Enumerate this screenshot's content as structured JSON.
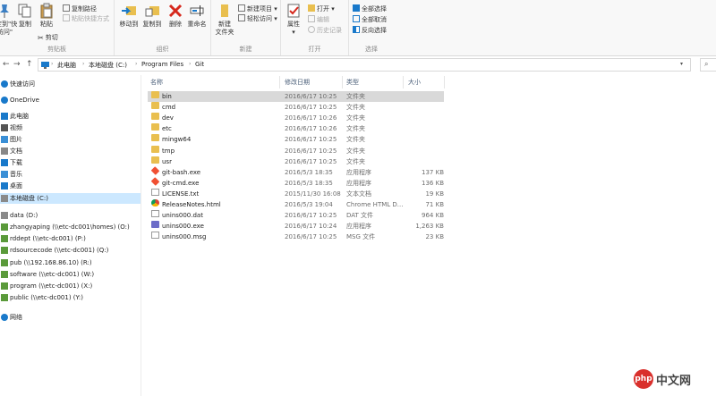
{
  "ribbon": {
    "clipboard": {
      "pin_label": "固定到\"快\n速访问\"",
      "copy_label": "复制",
      "paste_label": "粘贴",
      "copy_path_label": "复制路径",
      "paste_shortcut_label": "粘贴快捷方式",
      "cut_label": "剪切",
      "group_title": "剪贴板"
    },
    "organize": {
      "move_to_label": "移动到",
      "copy_to_label": "复制到",
      "delete_label": "删除",
      "rename_label": "重命名",
      "group_title": "组织"
    },
    "new": {
      "new_folder_label": "新建\n文件夹",
      "new_item_label": "新建项目",
      "easy_access_label": "轻松访问",
      "group_title": "新建"
    },
    "open": {
      "properties_label": "属性",
      "open_label": "打开",
      "edit_label": "编辑",
      "history_label": "历史记录",
      "group_title": "打开"
    },
    "select": {
      "select_all_label": "全部选择",
      "select_none_label": "全部取消",
      "invert_label": "反向选择",
      "group_title": "选择"
    }
  },
  "address": {
    "back": "←",
    "forward": "→",
    "up": "↑",
    "crumbs": [
      "此电脑",
      "本地磁盘 (C:)",
      "Program Files",
      "Git"
    ]
  },
  "nav": {
    "items": [
      {
        "label": "快速访问",
        "icon": "star-icon"
      },
      {
        "label": "OneDrive",
        "icon": "cloud-icon"
      },
      {
        "label": "此电脑",
        "icon": "computer-icon"
      },
      {
        "label": "视频",
        "icon": "video-icon"
      },
      {
        "label": "图片",
        "icon": "picture-icon"
      },
      {
        "label": "文档",
        "icon": "document-icon"
      },
      {
        "label": "下载",
        "icon": "download-icon"
      },
      {
        "label": "音乐",
        "icon": "music-icon"
      },
      {
        "label": "桌面",
        "icon": "desktop-icon"
      },
      {
        "label": "本地磁盘 (C:)",
        "icon": "drive-icon"
      },
      {
        "label": "data (D:)",
        "icon": "drive-icon"
      },
      {
        "label": "zhangyaping (\\\\etc-dc001\\homes) (O:)",
        "icon": "network-drive-icon"
      },
      {
        "label": "rddept (\\\\etc-dc001) (P:)",
        "icon": "network-drive-icon"
      },
      {
        "label": "rdsourcecode (\\\\etc-dc001) (Q:)",
        "icon": "network-drive-icon"
      },
      {
        "label": "pub (\\\\192.168.86.10) (R:)",
        "icon": "network-drive-icon"
      },
      {
        "label": "software (\\\\etc-dc001) (W:)",
        "icon": "network-drive-icon"
      },
      {
        "label": "program (\\\\etc-dc001) (X:)",
        "icon": "network-drive-icon"
      },
      {
        "label": "public (\\\\etc-dc001) (Y:)",
        "icon": "network-drive-icon"
      },
      {
        "label": "网络",
        "icon": "network-icon"
      }
    ]
  },
  "columns": {
    "name": "名称",
    "date": "修改日期",
    "type": "类型",
    "size": "大小"
  },
  "files": [
    {
      "name": "bin",
      "date": "2016/6/17 10:25",
      "type": "文件夹",
      "size": "",
      "icon": "folder-icon"
    },
    {
      "name": "cmd",
      "date": "2016/6/17 10:25",
      "type": "文件夹",
      "size": "",
      "icon": "folder-icon"
    },
    {
      "name": "dev",
      "date": "2016/6/17 10:26",
      "type": "文件夹",
      "size": "",
      "icon": "folder-icon"
    },
    {
      "name": "etc",
      "date": "2016/6/17 10:26",
      "type": "文件夹",
      "size": "",
      "icon": "folder-icon"
    },
    {
      "name": "mingw64",
      "date": "2016/6/17 10:25",
      "type": "文件夹",
      "size": "",
      "icon": "folder-icon"
    },
    {
      "name": "tmp",
      "date": "2016/6/17 10:25",
      "type": "文件夹",
      "size": "",
      "icon": "folder-icon"
    },
    {
      "name": "usr",
      "date": "2016/6/17 10:25",
      "type": "文件夹",
      "size": "",
      "icon": "folder-icon"
    },
    {
      "name": "git-bash.exe",
      "date": "2016/5/3 18:35",
      "type": "应用程序",
      "size": "137 KB",
      "icon": "git-icon"
    },
    {
      "name": "git-cmd.exe",
      "date": "2016/5/3 18:35",
      "type": "应用程序",
      "size": "136 KB",
      "icon": "git-icon"
    },
    {
      "name": "LICENSE.txt",
      "date": "2015/11/30 16:08",
      "type": "文本文档",
      "size": "19 KB",
      "icon": "text-file-icon"
    },
    {
      "name": "ReleaseNotes.html",
      "date": "2016/5/3 19:04",
      "type": "Chrome HTML D...",
      "size": "71 KB",
      "icon": "chrome-icon"
    },
    {
      "name": "unins000.dat",
      "date": "2016/6/17 10:25",
      "type": "DAT 文件",
      "size": "964 KB",
      "icon": "file-icon"
    },
    {
      "name": "unins000.exe",
      "date": "2016/6/17 10:24",
      "type": "应用程序",
      "size": "1,263 KB",
      "icon": "installer-icon"
    },
    {
      "name": "unins000.msg",
      "date": "2016/6/17 10:25",
      "type": "MSG 文件",
      "size": "23 KB",
      "icon": "file-icon"
    }
  ],
  "watermark": {
    "logo": "php",
    "text": "中文网"
  },
  "colors": {
    "selection": "#cce8ff",
    "folder": "#e9bf4f",
    "accent": "#1979ca"
  }
}
